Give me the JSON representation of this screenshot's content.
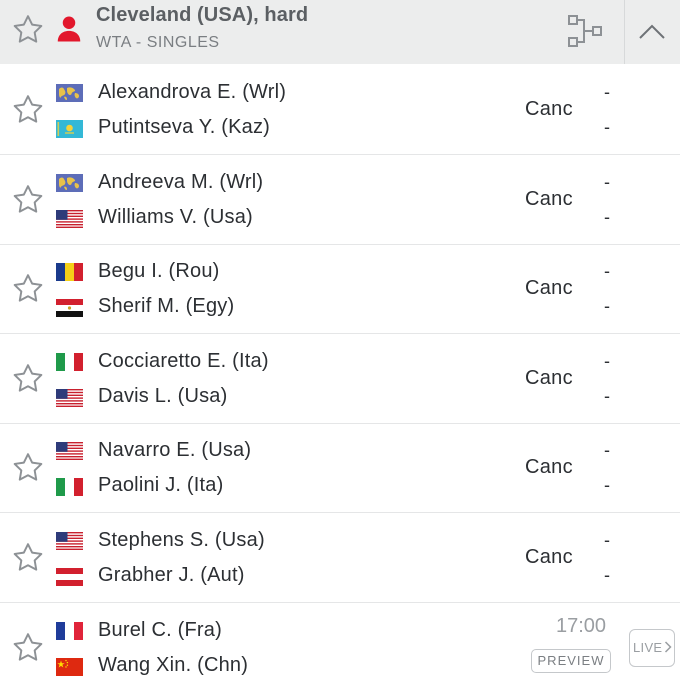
{
  "header": {
    "title": "Cleveland (USA), hard",
    "subtitle": "WTA - SINGLES",
    "icons": [
      "star-outline-icon",
      "person-icon",
      "draw-bracket-icon",
      "chevron-up-icon"
    ],
    "colors": {
      "person": "#e2172c",
      "background": "#eceded"
    }
  },
  "matches": [
    {
      "players": [
        {
          "name": "Alexandrova E. (Wrl)",
          "flag": "world-flag"
        },
        {
          "name": "Putintseva Y. (Kaz)",
          "flag": "kazakhstan-flag"
        }
      ],
      "status": "Canc",
      "scores": [
        "-",
        "-"
      ]
    },
    {
      "players": [
        {
          "name": "Andreeva M. (Wrl)",
          "flag": "world-flag"
        },
        {
          "name": "Williams V. (Usa)",
          "flag": "usa-flag"
        }
      ],
      "status": "Canc",
      "scores": [
        "-",
        "-"
      ]
    },
    {
      "players": [
        {
          "name": "Begu I. (Rou)",
          "flag": "romania-flag"
        },
        {
          "name": "Sherif M. (Egy)",
          "flag": "egypt-flag"
        }
      ],
      "status": "Canc",
      "scores": [
        "-",
        "-"
      ]
    },
    {
      "players": [
        {
          "name": "Cocciaretto E. (Ita)",
          "flag": "italy-flag"
        },
        {
          "name": "Davis L. (Usa)",
          "flag": "usa-flag"
        }
      ],
      "status": "Canc",
      "scores": [
        "-",
        "-"
      ]
    },
    {
      "players": [
        {
          "name": "Navarro E. (Usa)",
          "flag": "usa-flag"
        },
        {
          "name": "Paolini J. (Ita)",
          "flag": "italy-flag"
        }
      ],
      "status": "Canc",
      "scores": [
        "-",
        "-"
      ]
    },
    {
      "players": [
        {
          "name": "Stephens S. (Usa)",
          "flag": "usa-flag"
        },
        {
          "name": "Grabher J. (Aut)",
          "flag": "austria-flag"
        }
      ],
      "status": "Canc",
      "scores": [
        "-",
        "-"
      ]
    },
    {
      "players": [
        {
          "name": "Burel C. (Fra)",
          "flag": "france-flag"
        },
        {
          "name": "Wang Xin. (Chn)",
          "flag": "china-flag"
        }
      ],
      "time": "17:00",
      "preview_label": "PREVIEW",
      "live_label": "LIVE"
    }
  ]
}
